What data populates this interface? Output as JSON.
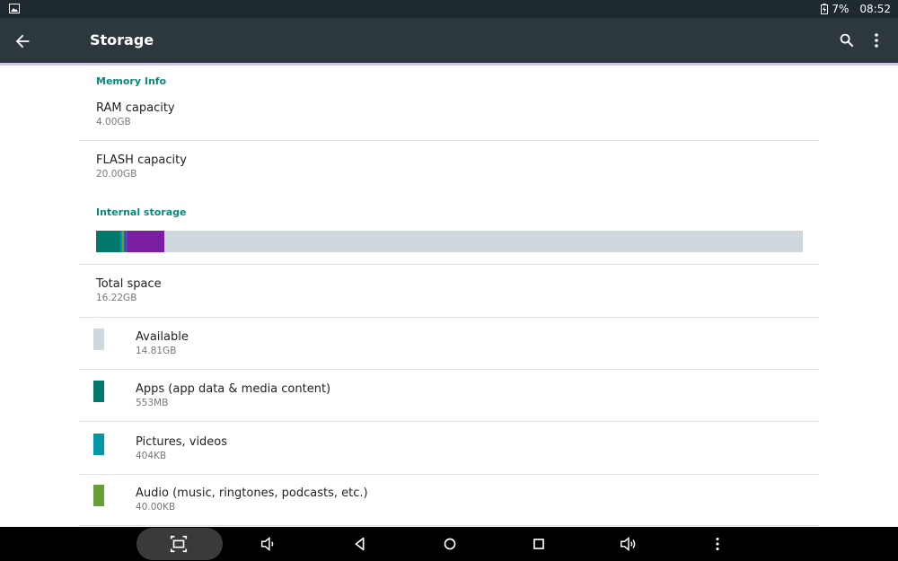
{
  "status_bar": {
    "battery_percent": "7%",
    "time": "08:52",
    "left_icon": "image-notification-icon",
    "battery_icon": "battery-charging-icon"
  },
  "app_bar": {
    "title": "Storage",
    "back_icon": "arrow-back-icon",
    "search_icon": "search-icon",
    "menu_icon": "more-vert-icon"
  },
  "memory_info": {
    "header": "Memory Info",
    "items": [
      {
        "label": "RAM capacity",
        "value": "4.00GB"
      },
      {
        "label": "FLASH capacity",
        "value": "20.00GB"
      }
    ]
  },
  "internal_storage": {
    "header": "Internal storage",
    "usage_bar": [
      {
        "category": "Apps (app data & media content)",
        "fraction": 0.034,
        "color": "#00796b"
      },
      {
        "category": "Pictures, videos",
        "fraction": 0.003,
        "color": "#0097a7"
      },
      {
        "category": "Audio (music, ringtones, podcasts, etc.)",
        "fraction": 0.003,
        "color": "#689f38"
      },
      {
        "category": "other-1",
        "fraction": 0.005,
        "color": "#3f51b5"
      },
      {
        "category": "other-2",
        "fraction": 0.052,
        "color": "#7b1fa2"
      }
    ],
    "bar_background": "#cfd8dc",
    "total": {
      "label": "Total space",
      "value": "16.22GB"
    },
    "legend": [
      {
        "label": "Available",
        "value": "14.81GB",
        "color": "#cfd8dc"
      },
      {
        "label": "Apps (app data & media content)",
        "value": "553MB",
        "color": "#00796b"
      },
      {
        "label": "Pictures, videos",
        "value": "404KB",
        "color": "#0097a7"
      },
      {
        "label": "Audio (music, ringtones, podcasts, etc.)",
        "value": "40.00KB",
        "color": "#689f38"
      }
    ]
  },
  "colors": {
    "accent": "#0a8a7c",
    "app_bar": "#2d383e",
    "status_bar": "#1f2a30"
  },
  "nav_bar": {
    "icons": [
      "screenshot-icon",
      "volume-down-icon",
      "back-triangle-icon",
      "home-circle-icon",
      "recents-square-icon",
      "volume-up-icon",
      "more-vert-icon"
    ]
  }
}
